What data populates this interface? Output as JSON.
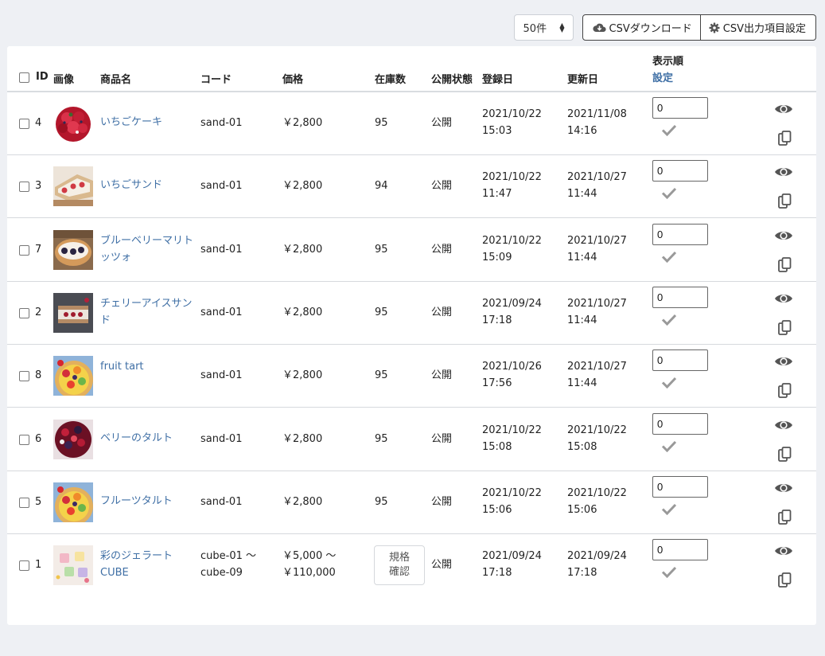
{
  "toolbar": {
    "per_page": "50件",
    "csv_download": "CSVダウンロード",
    "csv_settings": "CSV出力項目設定"
  },
  "header": {
    "id": "ID",
    "image": "画像",
    "name": "商品名",
    "code": "コード",
    "price": "価格",
    "stock": "在庫数",
    "status": "公開状態",
    "created": "登録日",
    "updated": "更新日",
    "order": "表示順",
    "order_link": "設定"
  },
  "rows": [
    {
      "id": "4",
      "name": "いちごケーキ",
      "code": "sand-01",
      "price": "￥2,800",
      "stock": "95",
      "status": "公開",
      "created": "2021/10/22\n15:03",
      "updated": "2021/11/08\n14:16",
      "order": "0",
      "thumb": "strawberry-cake"
    },
    {
      "id": "3",
      "name": "いちごサンド",
      "code": "sand-01",
      "price": "￥2,800",
      "stock": "94",
      "status": "公開",
      "created": "2021/10/22\n11:47",
      "updated": "2021/10/27\n11:44",
      "order": "0",
      "thumb": "strawberry-sandwich"
    },
    {
      "id": "7",
      "name": "ブルーベリーマリトッツォ",
      "code": "sand-01",
      "price": "￥2,800",
      "stock": "95",
      "status": "公開",
      "created": "2021/10/22\n15:09",
      "updated": "2021/10/27\n11:44",
      "order": "0",
      "thumb": "blueberry-maritozzo"
    },
    {
      "id": "2",
      "name": "チェリーアイスサンド",
      "code": "sand-01",
      "price": "￥2,800",
      "stock": "95",
      "status": "公開",
      "created": "2021/09/24\n17:18",
      "updated": "2021/10/27\n11:44",
      "order": "0",
      "thumb": "cherry-ice-sandwich"
    },
    {
      "id": "8",
      "name": "fruit tart",
      "code": "sand-01",
      "price": "￥2,800",
      "stock": "95",
      "status": "公開",
      "created": "2021/10/26\n17:56",
      "updated": "2021/10/27\n11:44",
      "order": "0",
      "thumb": "fruit-tart"
    },
    {
      "id": "6",
      "name": "ベリーのタルト",
      "code": "sand-01",
      "price": "￥2,800",
      "stock": "95",
      "status": "公開",
      "created": "2021/10/22\n15:08",
      "updated": "2021/10/22\n15:08",
      "order": "0",
      "thumb": "berry-tart"
    },
    {
      "id": "5",
      "name": "フルーツタルト",
      "code": "sand-01",
      "price": "￥2,800",
      "stock": "95",
      "status": "公開",
      "created": "2021/10/22\n15:06",
      "updated": "2021/10/22\n15:06",
      "order": "0",
      "thumb": "fruit-tart"
    },
    {
      "id": "1",
      "name": "彩のジェラートCUBE",
      "code": "cube-01 ～\ncube-09",
      "price": "￥5,000 ～\n￥110,000",
      "stock": "",
      "stock_button": "規格\n確認",
      "status": "公開",
      "created": "2021/09/24\n17:18",
      "updated": "2021/09/24\n17:18",
      "order": "0",
      "thumb": "gelato-cube"
    }
  ],
  "colors": {
    "link": "#3f6fa5",
    "page_bg": "#eef0f4",
    "icon": "#555555",
    "check": "#999999"
  },
  "icons": {
    "view": "eye-icon",
    "duplicate": "copy-icon",
    "confirm": "check-icon",
    "download": "cloud-download-icon",
    "settings": "gear-icon"
  }
}
